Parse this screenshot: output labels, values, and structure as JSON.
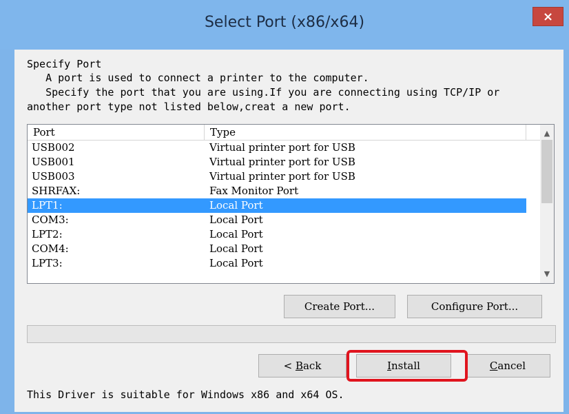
{
  "window": {
    "title": "Select Port (x86/x64)",
    "close_label": "×"
  },
  "intro": {
    "heading": "Specify Port",
    "line1": "   A port is used to connect a printer to the computer.",
    "line2": "   Specify the port that you are using.If you are connecting using TCP/IP or",
    "line3": "another port type not listed below,creat a new port."
  },
  "port_list": {
    "columns": [
      "Port",
      "Type"
    ],
    "rows": [
      {
        "port": "USB002",
        "type": "Virtual printer port for USB"
      },
      {
        "port": "USB001",
        "type": "Virtual printer port for USB"
      },
      {
        "port": "USB003",
        "type": "Virtual printer port for USB"
      },
      {
        "port": "SHRFAX:",
        "type": "Fax Monitor Port"
      },
      {
        "port": "LPT1:",
        "type": "Local Port"
      },
      {
        "port": "COM3:",
        "type": "Local Port"
      },
      {
        "port": "LPT2:",
        "type": "Local Port"
      },
      {
        "port": "COM4:",
        "type": "Local Port"
      },
      {
        "port": "LPT3:",
        "type": "Local Port"
      }
    ],
    "selected_index": 4,
    "scroll_up_icon": "chevron-up-icon",
    "scroll_down_icon": "chevron-down-icon"
  },
  "buttons": {
    "create_port": "Create Port...",
    "configure_port": "Configure Port...",
    "back_prefix": "< ",
    "back_key": "B",
    "back_rest": "ack",
    "install_key": "I",
    "install_rest": "nstall",
    "cancel_key": "C",
    "cancel_rest": "ancel"
  },
  "footer": {
    "note": "This Driver is suitable for Windows x86 and x64 OS."
  },
  "colors": {
    "title_bar": "#7fb6ec",
    "close_button": "#c7473f",
    "selection": "#3399ff",
    "highlight_box": "#e0141e"
  }
}
